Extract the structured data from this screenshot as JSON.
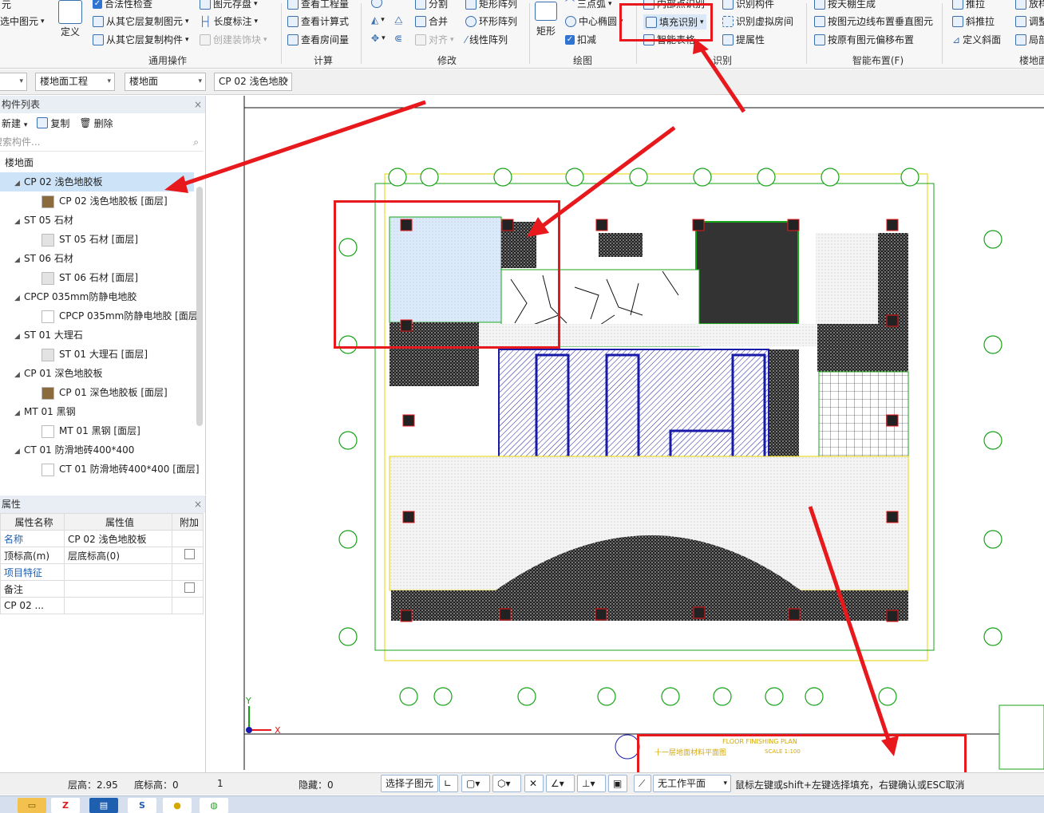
{
  "ribbon": {
    "col1": {
      "a": "元",
      "b": "选中图元"
    },
    "define": "定义",
    "validity_check": "合法性检查",
    "copy_from_floor": "从其它层复制图元",
    "copy_from_comp": "从其它层复制构件",
    "layer_save": "图元存盘",
    "length_label": "长度标注",
    "create_decor": "创建装饰块",
    "general_group": "通用操作",
    "view_quantity": "查看工程量",
    "view_formula": "查看计算式",
    "view_room_qty": "查看房间量",
    "calc_group": "计算",
    "split": "分割",
    "merge": "合并",
    "align": "对齐",
    "rect_array": "矩形阵列",
    "ring_array": "环形阵列",
    "linear_array": "线性阵列",
    "modify_group": "修改",
    "rect_big": "矩形",
    "three_arc": "三点弧",
    "center_ellipse": "中心椭圆",
    "deduct": "扣减",
    "draw_group": "绘图",
    "inner_point": "内部点识别",
    "fill_recognize": "填充识别",
    "smart_table": "智能表格",
    "recognize_comp": "识别构件",
    "recognize_virtual_room": "识别虚拟房间",
    "extract_attr": "提属性",
    "recognize_group": "识别",
    "ceiling_gen": "按天棚生成",
    "edge_layout": "按图元边线布置垂直图元",
    "offset_layout": "按原有图元偏移布置",
    "smart_layout_group": "智能布置(F)",
    "push_pull": "推拉",
    "slope_push": "斜推拉",
    "define_slope": "定义斜面",
    "rotate": "放样",
    "adjust": "调整",
    "local": "局部",
    "floor_group": "楼地面"
  },
  "toolbar2": {
    "project": "楼地面工程",
    "category": "楼地面",
    "component": "CP 02 浅色地胶"
  },
  "left_panel": {
    "title": "构件列表",
    "new": "新建",
    "copy": "复制",
    "delete": "删除",
    "search_placeholder": "搜索构件...",
    "root": "楼地面",
    "tree": [
      {
        "label": "CP 02 浅色地胶板",
        "child": "CP 02 浅色地胶板 [面层]",
        "tex": "#8b6a3e"
      },
      {
        "label": "ST 05 石材",
        "child": "ST 05 石材 [面层]",
        "tex": "#e3e3e3"
      },
      {
        "label": "ST 06 石材",
        "child": "ST 06 石材 [面层]",
        "tex": "#e3e3e3"
      },
      {
        "label": "CPCP 035mm防静电地胶",
        "child": "CPCP 035mm防静电地胶 [面层]",
        "tex": "#ffffff"
      },
      {
        "label": "ST 01 大理石",
        "child": "ST 01 大理石 [面层]",
        "tex": "#e3e3e3"
      },
      {
        "label": "CP 01 深色地胶板",
        "child": "CP 01 深色地胶板 [面层]",
        "tex": "#8b6a3e"
      },
      {
        "label": "MT 01 黑钢",
        "child": "MT 01 黑钢 [面层]",
        "tex": "#ffffff"
      },
      {
        "label": "CT 01 防滑地砖400*400",
        "child": "CT 01 防滑地砖400*400 [面层]",
        "tex": "#ffffff"
      }
    ]
  },
  "props": {
    "title": "属性",
    "headers": [
      "属性名称",
      "属性值",
      "附加"
    ],
    "rows": [
      {
        "name": "名称",
        "value": "CP 02 浅色地胶板",
        "check": false
      },
      {
        "name": "顶标高(m)",
        "value": "层底标高(0)",
        "check": true
      },
      {
        "name": "项目特征",
        "value": "",
        "check": false
      },
      {
        "name": "备注",
        "value": "",
        "check": true
      },
      {
        "name": "CP 02 ...",
        "value": "",
        "check": false
      }
    ]
  },
  "drawing": {
    "title_text": "FLOOR FINISHING PLAN",
    "subtitle": "十一层地面材料平面图",
    "scale": "SCALE 1:100",
    "axis_x": "X",
    "axis_y": "Y"
  },
  "status": {
    "floor_height": "层高：2.95",
    "bottom_height": "底标高：0",
    "count": "1",
    "hidden": "隐藏：0",
    "select_child": "选择子图元",
    "work_plane": "无工作平面",
    "hint": "鼠标左键或shift+左键选择填充，右键确认或ESC取消"
  },
  "colors": {
    "accent_red": "#e8191c",
    "selection": "#cde3f7",
    "cad_yellow": "#e6d400",
    "cad_green": "#17a317",
    "cad_blue": "#1a1aa8"
  }
}
